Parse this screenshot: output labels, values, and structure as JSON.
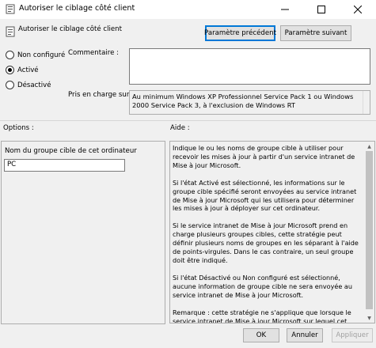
{
  "window": {
    "title": "Autoriser le ciblage côté client"
  },
  "header": {
    "title": "Autoriser le ciblage côté client",
    "prev_button": "Paramètre précédent",
    "next_button": "Paramètre suivant"
  },
  "state": {
    "options": [
      {
        "label": "Non configuré",
        "checked": false
      },
      {
        "label": "Activé",
        "checked": true
      },
      {
        "label": "Désactivé",
        "checked": false
      }
    ]
  },
  "comment": {
    "label": "Commentaire :",
    "value": ""
  },
  "supported": {
    "label": "Pris en charge sur :",
    "value": "Au minimum Windows XP Professionnel Service Pack 1 ou Windows 2000 Service Pack 3, à l'exclusion de Windows RT"
  },
  "options_section": {
    "label": "Options :",
    "field_label": "Nom du groupe cible de cet ordinateur",
    "field_value": "PC"
  },
  "help_section": {
    "label": "Aide :",
    "paragraphs": [
      "Indique le ou les noms de groupe cible à utiliser pour recevoir les mises à jour à partir d'un service intranet de Mise à jour Microsoft.",
      "Si l'état Activé est sélectionné, les informations sur le groupe cible spécifié seront envoyées au service intranet de Mise à jour Microsoft qui les utilisera pour déterminer les mises à jour à déployer sur cet ordinateur.",
      "Si le service intranet de Mise à jour Microsoft prend en charge plusieurs groupes cibles, cette stratégie peut définir plusieurs noms de groupes en les séparant à l'aide de points-virgules. Dans le cas contraire, un seul groupe doit être indiqué.",
      "Si l'état Désactivé ou Non configuré est sélectionné, aucune information de groupe cible ne sera envoyée au service intranet de Mise à jour Microsoft.",
      "Remarque : cette stratégie ne s'applique que lorsque le service intranet de Mise à jour Microsoft sur lequel cet ordinateur est dirigé est configuré pour prendre en charge le ciblage côté client. Si la stratégie « Spécifier l'emplacement intranet du service de"
    ]
  },
  "footer": {
    "ok": "OK",
    "cancel": "Annuler",
    "apply": "Appliquer"
  }
}
